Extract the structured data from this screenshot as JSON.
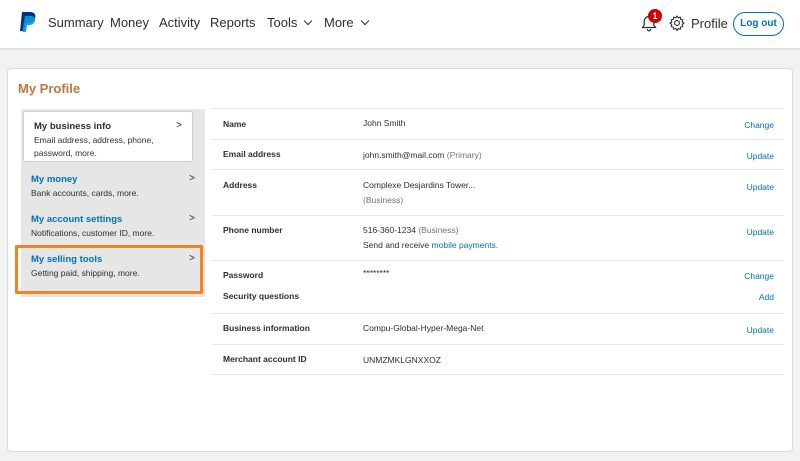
{
  "nav": {
    "items": [
      {
        "label": "Summary",
        "dropdown": false
      },
      {
        "label": "Money",
        "dropdown": false
      },
      {
        "label": "Activity",
        "dropdown": false
      },
      {
        "label": "Reports",
        "dropdown": false
      },
      {
        "label": "Tools",
        "dropdown": true
      },
      {
        "label": "More",
        "dropdown": true
      }
    ],
    "notification_count": "1",
    "profile_label": "Profile",
    "logout_label": "Log out",
    "logo_icon": "paypal-logo",
    "accent_color": "#0070ba"
  },
  "page": {
    "title": "My Profile",
    "title_color": "#c6743f",
    "highlight_color": "#f58220"
  },
  "sidebar": {
    "items": [
      {
        "title": "My business info",
        "desc": "Email address, address, phone, password, more.",
        "active": true
      },
      {
        "title": "My money",
        "desc": "Bank accounts, cards, more.",
        "active": false
      },
      {
        "title": "My account settings",
        "desc": "Notifications, customer ID, more.",
        "active": false
      },
      {
        "title": "My selling tools",
        "desc": "Getting paid, shipping, more.",
        "active": false,
        "highlighted": true
      }
    ],
    "arrow": ">"
  },
  "info": {
    "name": {
      "label": "Name",
      "value": "John Smith",
      "action": "Change"
    },
    "email": {
      "label": "Email address",
      "value": "john.smith@mail.com",
      "note": "(Primary)",
      "action": "Update"
    },
    "address": {
      "label": "Address",
      "value": "Complexe Desjardins Tower...",
      "note": "(Business)",
      "action": "Update"
    },
    "phone": {
      "label": "Phone number",
      "value": "516-360-1234",
      "note": "(Business)",
      "extra_text": "Send and receive",
      "extra_link": "mobile payments.",
      "action": "Update"
    },
    "password": {
      "label": "Password",
      "value": "********",
      "action": "Change"
    },
    "security": {
      "label": "Security questions",
      "action": "Add"
    },
    "business": {
      "label": "Business information",
      "value": "Compu-Global-Hyper-Mega-Net",
      "action": "Update"
    },
    "merchant": {
      "label": "Merchant account ID",
      "value": "UNMZMKLGNXXOZ"
    }
  }
}
